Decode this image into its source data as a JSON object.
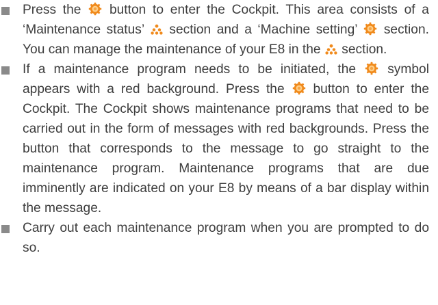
{
  "colors": {
    "text": "#3d3d3d",
    "bullet": "#8a8a8a",
    "icon_orange": "#f08a1c",
    "icon_orange_light": "#ffd08a"
  },
  "icons": {
    "gear": "maintenance-gear-icon",
    "warning": "maintenance-status-icon"
  },
  "items": [
    {
      "segments": {
        "s1": "Press the",
        "s2": "button to enter the Cockpit. This area consists of a ‘Maintenance status’",
        "s3": "section and a ‘Machine setting’",
        "s4": "section. You can manage the maintenance of your E8 in the",
        "s5": "section."
      }
    },
    {
      "segments": {
        "s1": "If a maintenance program needs to be initiated, the",
        "s2": "symbol appears with a red background. Press the",
        "s3": "button to enter the Cockpit. The Cockpit shows maintenance programs that need to be carried out in the form of messages with red backgrounds. Press the button that corresponds to the message to go straight to the maintenance program. Maintenance programs that are due imminently are indicated on your E8 by means of a bar display within the message."
      }
    },
    {
      "segments": {
        "s1": "Carry out each maintenance program when you are prompted to do so."
      }
    }
  ]
}
